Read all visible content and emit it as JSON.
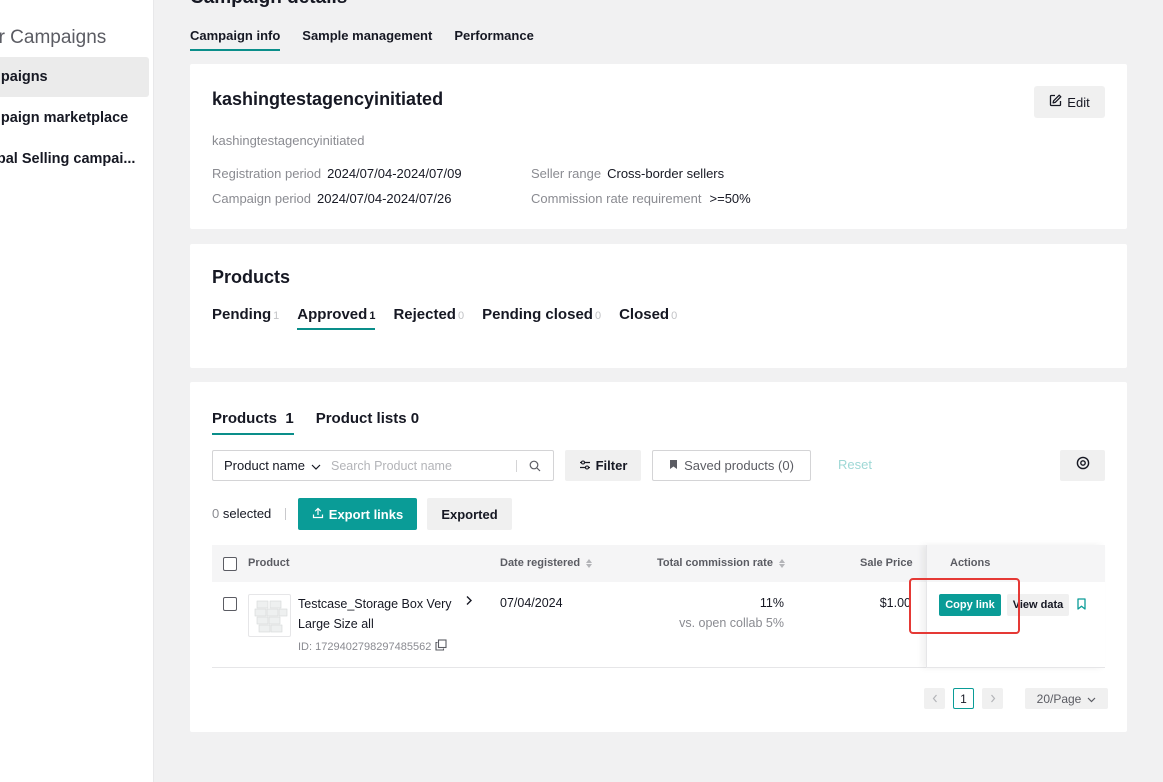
{
  "sidebar": {
    "title": "er Campaigns",
    "items": [
      {
        "label": "mpaigns"
      },
      {
        "label": "mpaign marketplace"
      },
      {
        "label": "obal Selling campai..."
      }
    ]
  },
  "header": {
    "title": "Campaign details",
    "tabs": [
      "Campaign info",
      "Sample management",
      "Performance"
    ]
  },
  "campaign": {
    "name": "kashingtestagencyinitiated",
    "subtitle": "kashingtestagencyinitiated",
    "edit_label": "Edit",
    "registration_label": "Registration period",
    "registration_value": "2024/07/04-2024/07/09",
    "campaign_label": "Campaign period",
    "campaign_value": "2024/07/04-2024/07/26",
    "seller_label": "Seller range",
    "seller_value": "Cross-border sellers",
    "commission_label": "Commission rate requirement",
    "commission_value": ">=50%"
  },
  "products_section": {
    "title": "Products",
    "status_tabs": [
      {
        "label": "Pending",
        "count": "1"
      },
      {
        "label": "Approved",
        "count": "1"
      },
      {
        "label": "Rejected",
        "count": "0"
      },
      {
        "label": "Pending closed",
        "count": "0"
      },
      {
        "label": "Closed",
        "count": "0"
      }
    ]
  },
  "list": {
    "tabs": [
      {
        "label": "Products",
        "count": "1"
      },
      {
        "label": "Product lists",
        "count": "0"
      }
    ],
    "search_select": "Product name",
    "search_placeholder": "Search Product name",
    "filter_label": "Filter",
    "saved_label": "Saved products (0)",
    "reset_label": "Reset",
    "selected_count": "0",
    "selected_label": "selected",
    "export_label": "Export links",
    "exported_label": "Exported",
    "columns": {
      "product": "Product",
      "date": "Date registered",
      "rate": "Total commission rate",
      "price": "Sale Price",
      "actions": "Actions"
    },
    "rows": [
      {
        "name": "Testcase_Storage Box Very Large Size all",
        "id": "ID: 1729402798297485562",
        "date": "07/04/2024",
        "rate": "11%",
        "rate_sub": "vs. open collab 5%",
        "price": "$1.00",
        "copy_label": "Copy link",
        "view_label": "View data"
      }
    ],
    "pager": {
      "page": "1",
      "size": "20/Page"
    }
  },
  "colors": {
    "accent": "#0a9c97",
    "highlight": "#e53935"
  }
}
